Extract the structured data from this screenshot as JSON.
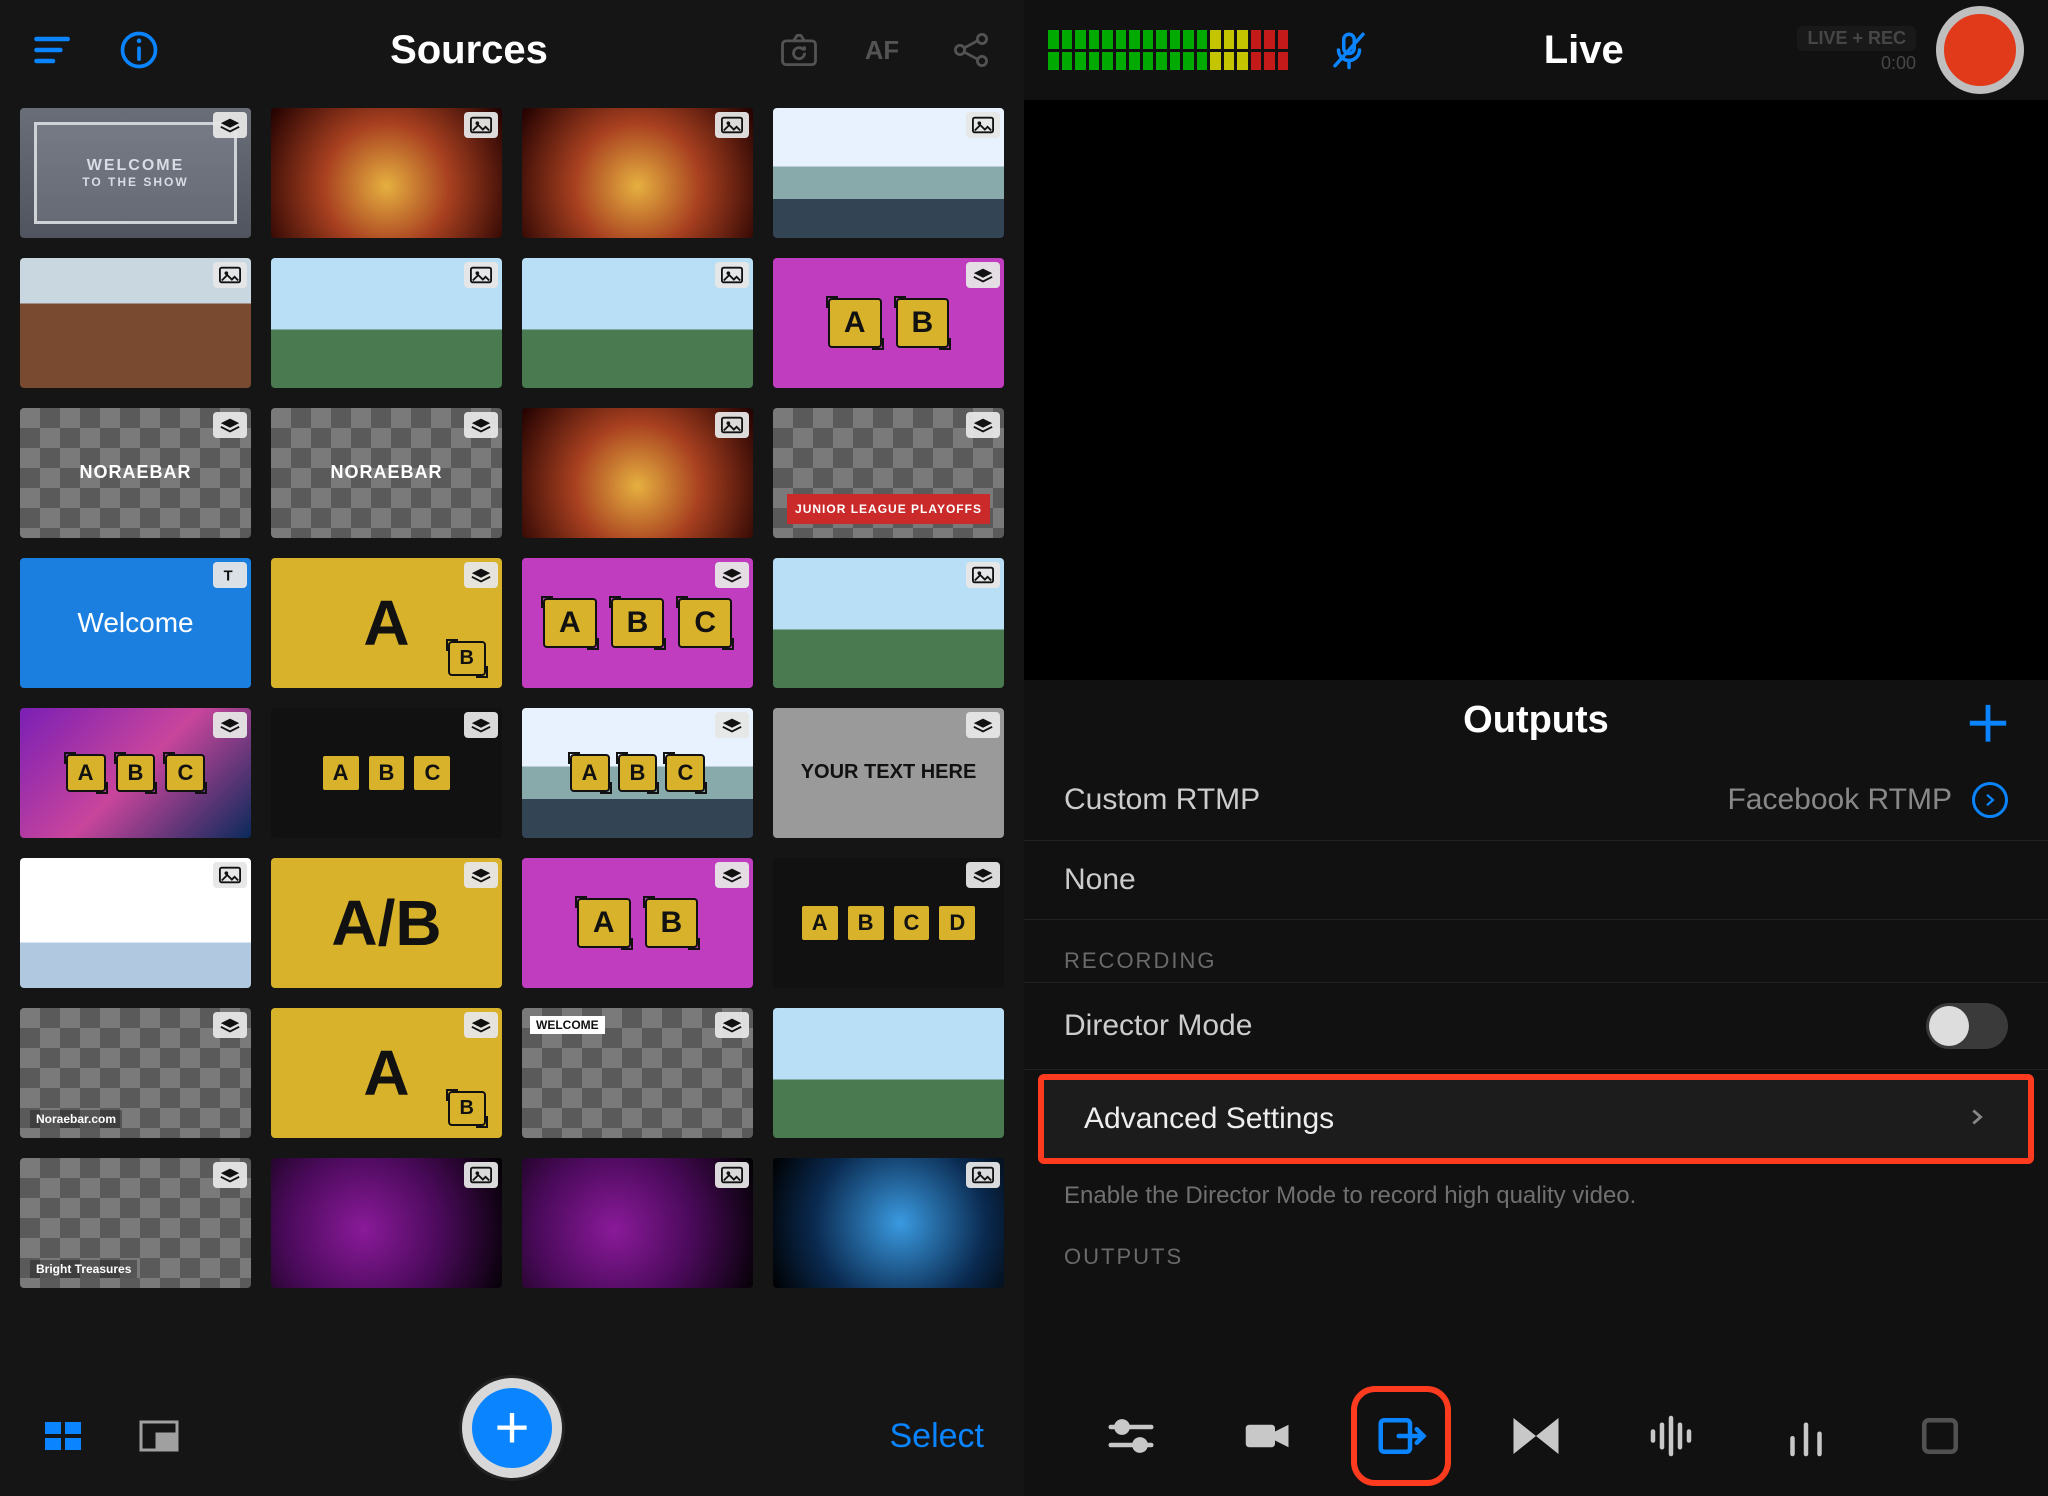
{
  "left": {
    "title": "Sources",
    "bottom": {
      "select": "Select"
    }
  },
  "right": {
    "title": "Live",
    "liverec_badge": "LIVE + REC",
    "liverec_time": "0:00",
    "outputs_header": "Outputs",
    "row_custom_rtmp": "Custom RTMP",
    "row_custom_rtmp_value": "Facebook RTMP",
    "row_none": "None",
    "section_recording": "RECORDING",
    "director_mode": "Director Mode",
    "advanced": "Advanced Settings",
    "hint": "Enable the Director Mode to record high quality video.",
    "section_outputs": "OUTPUTS"
  },
  "thumbs": [
    {
      "kind": "welcome",
      "text1": "WELCOME",
      "text2": "TO THE SHOW",
      "badge": "layers"
    },
    {
      "kind": "photo",
      "cls": "stage",
      "badge": "image"
    },
    {
      "kind": "photo",
      "cls": "stage",
      "badge": "image"
    },
    {
      "kind": "photo",
      "cls": "skyline",
      "badge": "image"
    },
    {
      "kind": "photo",
      "cls": "brick",
      "badge": "image"
    },
    {
      "kind": "photo",
      "cls": "city",
      "badge": "image"
    },
    {
      "kind": "photo",
      "cls": "city",
      "badge": "image"
    },
    {
      "kind": "magenta",
      "chips": [
        "A",
        "B"
      ],
      "badge": "layers"
    },
    {
      "kind": "checker",
      "label": "NORAEBAR",
      "small_pos": "right",
      "badge": "layers"
    },
    {
      "kind": "checker",
      "label": "NORAEBAR",
      "badge": "layers"
    },
    {
      "kind": "photo",
      "cls": "stage",
      "badge": "image"
    },
    {
      "kind": "checker",
      "ribbon": "JUNIOR LEAGUE PLAYOFFS",
      "badge": "layers"
    },
    {
      "kind": "blue",
      "label": "Welcome",
      "badge": "text"
    },
    {
      "kind": "yellow",
      "big": "A",
      "sub": "B",
      "badge": "layers"
    },
    {
      "kind": "magenta",
      "chips": [
        "A",
        "B",
        "C"
      ],
      "badge": "layers"
    },
    {
      "kind": "photo",
      "cls": "city",
      "badge": "image"
    },
    {
      "kind": "gradient",
      "chips": [
        "A",
        "B",
        "C"
      ],
      "badge": "layers"
    },
    {
      "kind": "yellow",
      "chips": [
        "A",
        "B",
        "C"
      ],
      "badge": "layers",
      "bg": "#111"
    },
    {
      "kind": "photo-chips",
      "cls": "skyline",
      "chips": [
        "A",
        "B",
        "C"
      ],
      "badge": "layers"
    },
    {
      "kind": "solid-gray",
      "text": "YOUR TEXT HERE",
      "badge": "layers"
    },
    {
      "kind": "photo",
      "cls": "snow",
      "badge": "image"
    },
    {
      "kind": "yellow",
      "big": "A/B",
      "badge": "layers"
    },
    {
      "kind": "magenta",
      "chips": [
        "A",
        "B"
      ],
      "badge": "layers"
    },
    {
      "kind": "yellow",
      "chips": [
        "A",
        "B",
        "C",
        "D"
      ],
      "badge": "layers",
      "bg": "#111"
    },
    {
      "kind": "checker",
      "small": "Noraebar.com",
      "badge": "layers"
    },
    {
      "kind": "yellow",
      "big": "A",
      "sub": "B",
      "badge": "layers"
    },
    {
      "kind": "checker",
      "small_top": "WELCOME",
      "badge": "layers"
    },
    {
      "kind": "photo",
      "cls": "city",
      "badge": ""
    },
    {
      "kind": "checker",
      "small": "Bright Treasures",
      "badge": "layers"
    },
    {
      "kind": "photo",
      "cls": "dark",
      "badge": "image"
    },
    {
      "kind": "photo",
      "cls": "dark",
      "badge": "image"
    },
    {
      "kind": "photo",
      "cls": "concert",
      "badge": "image"
    }
  ]
}
